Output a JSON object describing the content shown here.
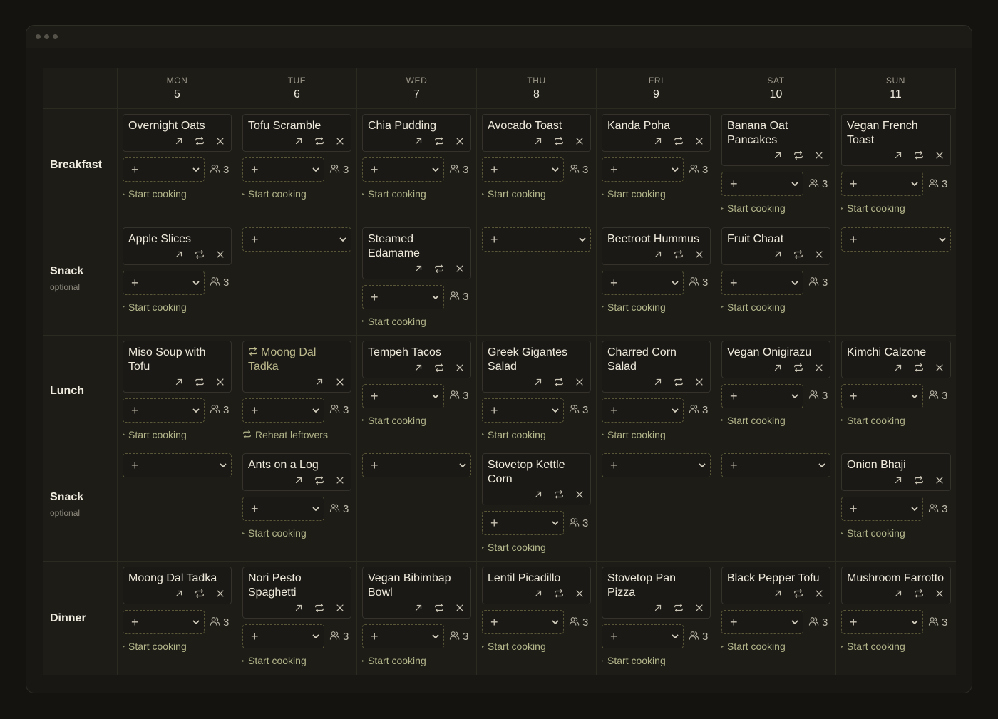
{
  "days": [
    {
      "name": "MON",
      "num": "5"
    },
    {
      "name": "TUE",
      "num": "6"
    },
    {
      "name": "WED",
      "num": "7"
    },
    {
      "name": "THU",
      "num": "8"
    },
    {
      "name": "FRI",
      "num": "9"
    },
    {
      "name": "SAT",
      "num": "10"
    },
    {
      "name": "SUN",
      "num": "11"
    }
  ],
  "meals": [
    {
      "name": "Breakfast",
      "sub": ""
    },
    {
      "name": "Snack",
      "sub": "optional"
    },
    {
      "name": "Lunch",
      "sub": ""
    },
    {
      "name": "Snack",
      "sub": "optional"
    },
    {
      "name": "Dinner",
      "sub": ""
    }
  ],
  "labels": {
    "start": "Start cooking",
    "reheat": "Reheat leftovers",
    "add": "+",
    "servings": "3"
  },
  "grid": [
    [
      {
        "title": "Overnight Oats"
      },
      {
        "title": "Tofu Scramble"
      },
      {
        "title": "Chia Pudding"
      },
      {
        "title": "Avocado Toast"
      },
      {
        "title": "Kanda Poha"
      },
      {
        "title": "Banana Oat Pancakes"
      },
      {
        "title": "Vegan French Toast"
      }
    ],
    [
      {
        "title": "Apple Slices"
      },
      null,
      {
        "title": "Steamed Edamame"
      },
      null,
      {
        "title": "Beetroot Hummus"
      },
      {
        "title": "Fruit Chaat"
      },
      null
    ],
    [
      {
        "title": "Miso Soup with Tofu"
      },
      {
        "title": "Moong Dal Tadka",
        "leftover": true
      },
      {
        "title": "Tempeh Tacos"
      },
      {
        "title": "Greek Gigantes Salad"
      },
      {
        "title": "Charred Corn Salad"
      },
      {
        "title": "Vegan Onigirazu"
      },
      {
        "title": "Kimchi Calzone"
      }
    ],
    [
      null,
      {
        "title": "Ants on a Log"
      },
      null,
      {
        "title": "Stovetop Kettle Corn"
      },
      null,
      null,
      {
        "title": "Onion Bhaji"
      }
    ],
    [
      {
        "title": "Moong Dal Tadka"
      },
      {
        "title": "Nori Pesto Spaghetti"
      },
      {
        "title": "Vegan Bibimbap Bowl"
      },
      {
        "title": "Lentil Picadillo"
      },
      {
        "title": "Stovetop Pan Pizza"
      },
      {
        "title": "Black Pepper Tofu"
      },
      {
        "title": "Mushroom Farrotto"
      }
    ]
  ],
  "colors": {
    "accent": "#b3b58a",
    "dashed": "#5a5738",
    "bg": "#1d1c17"
  }
}
